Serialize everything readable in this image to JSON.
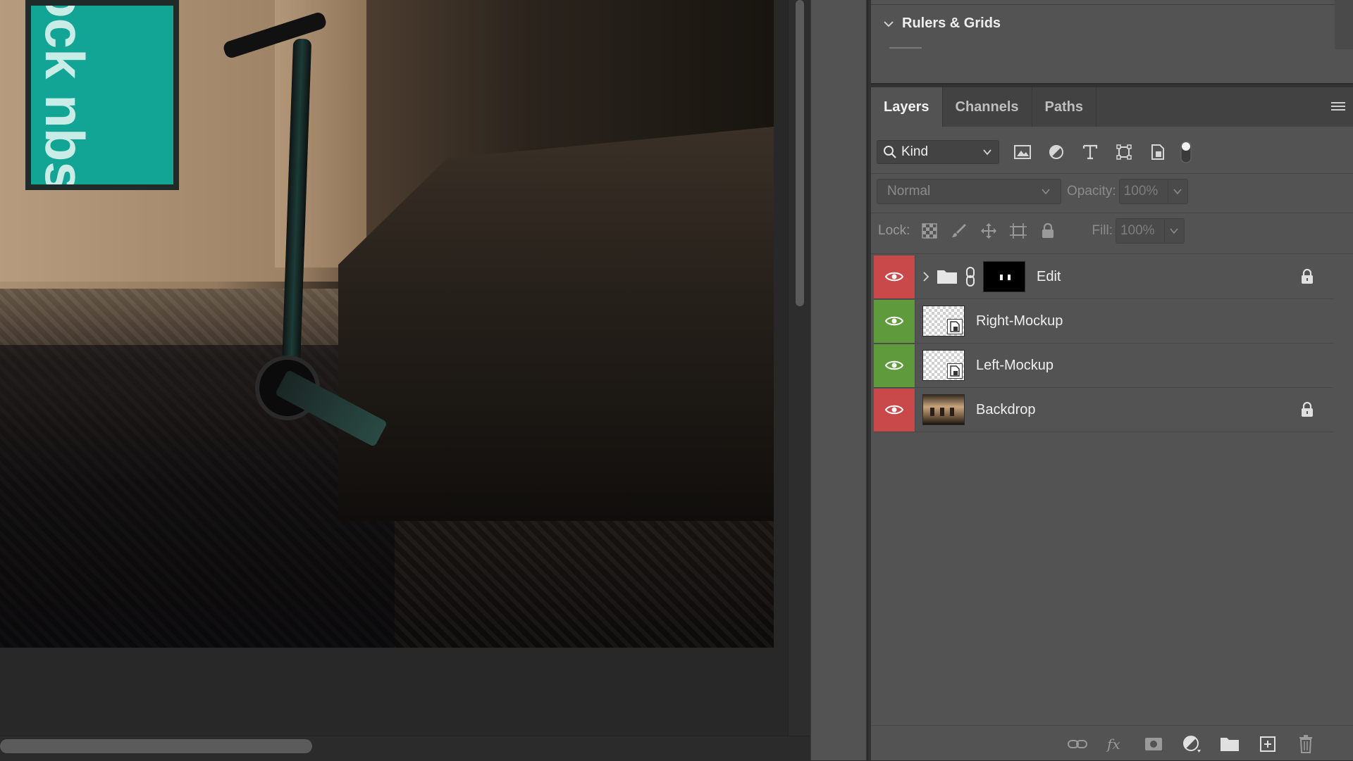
{
  "canvas": {
    "poster_text": "ock nbs locs"
  },
  "rulers_panel": {
    "title": "Rulers & Grids"
  },
  "layers_panel": {
    "tabs": [
      {
        "label": "Layers",
        "active": true
      },
      {
        "label": "Channels",
        "active": false
      },
      {
        "label": "Paths",
        "active": false
      }
    ],
    "filter": {
      "kind_label": "Kind",
      "icons": [
        "image-filter-icon",
        "adjustment-filter-icon",
        "type-filter-icon",
        "shape-filter-icon",
        "smart-object-filter-icon"
      ]
    },
    "blend_mode": "Normal",
    "opacity_label": "Opacity:",
    "opacity_value": "100%",
    "lock_label": "Lock:",
    "fill_label": "Fill:",
    "fill_value": "100%",
    "layers": [
      {
        "name": "Edit",
        "type": "group",
        "eye_color": "#c9484a",
        "locked": true
      },
      {
        "name": "Right-Mockup",
        "type": "smart-object",
        "eye_color": "#5f9a3c",
        "locked": false
      },
      {
        "name": "Left-Mockup",
        "type": "smart-object",
        "eye_color": "#5f9a3c",
        "locked": false
      },
      {
        "name": "Backdrop",
        "type": "image",
        "eye_color": "#c9484a",
        "locked": true
      }
    ]
  }
}
